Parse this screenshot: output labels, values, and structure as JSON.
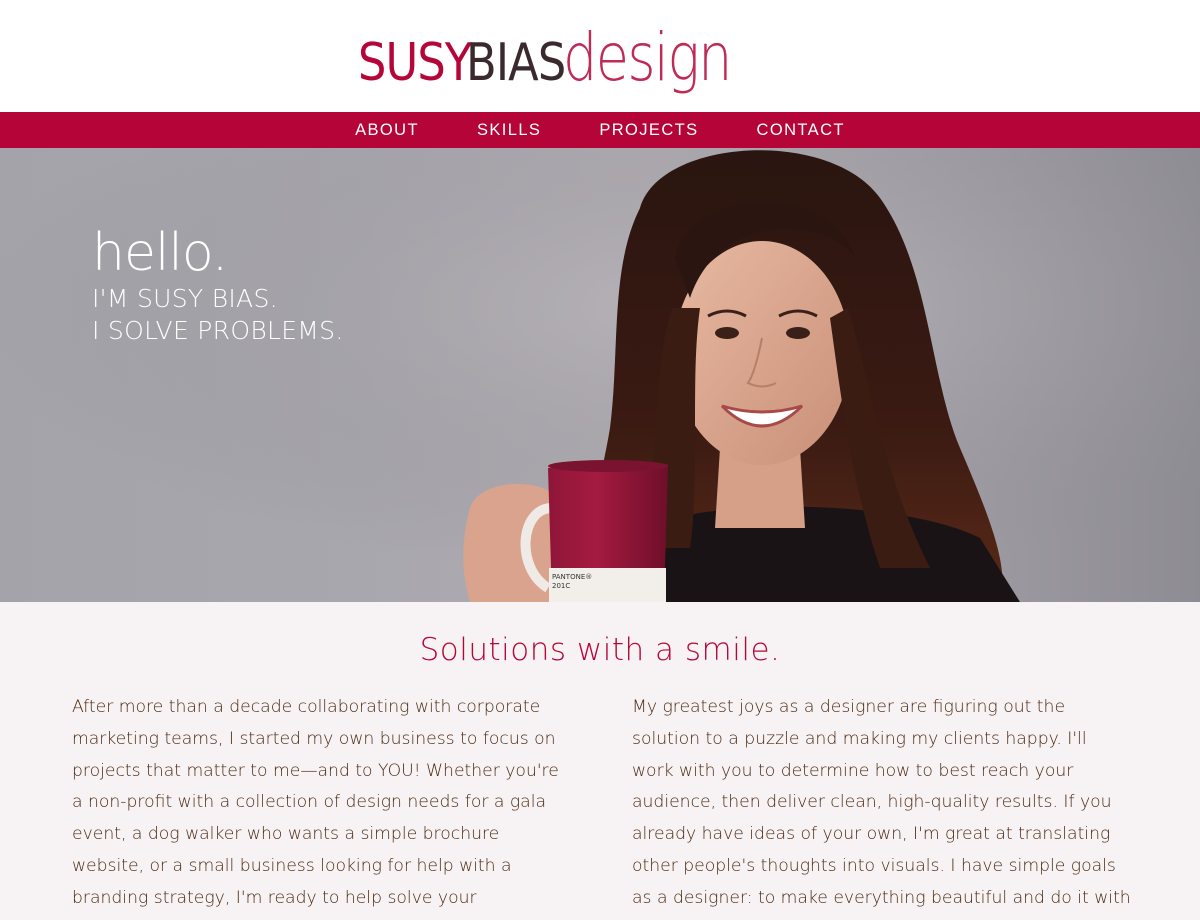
{
  "logo": {
    "part1": "SUSY",
    "part2": "BIAS",
    "part3": "design"
  },
  "nav": {
    "items": [
      "ABOUT",
      "SKILLS",
      "PROJECTS",
      "CONTACT"
    ]
  },
  "hero": {
    "greeting": "hello.",
    "line1": "I'M SUSY BIAS.",
    "line2": "I SOLVE PROBLEMS.",
    "mug_label": "PANTONE®",
    "mug_code": "201C"
  },
  "content": {
    "headline": "Solutions with a smile.",
    "col_left": "After more than a decade collaborating with corporate marketing teams, I started my own business to focus on projects that matter to me—and to YOU! Whether you're a non-profit with a collection of design needs for a gala event, a dog walker who wants a simple brochure website, or a small business looking for help with a branding strategy, I'm ready to help solve your problems.",
    "col_right": "My greatest joys as a designer are figuring out the solution to a puzzle and making my clients happy. I'll work with you to determine how to best reach your audience, then deliver clean, high-quality results. If you already have ideas of your own, I'm great at translating other people's thoughts into visuals. I have simple goals as a designer: to make everything beautiful and do it with a smile."
  },
  "colors": {
    "brand": "#b40438",
    "text": "#4a2a12",
    "background": "#f7f3f4"
  }
}
